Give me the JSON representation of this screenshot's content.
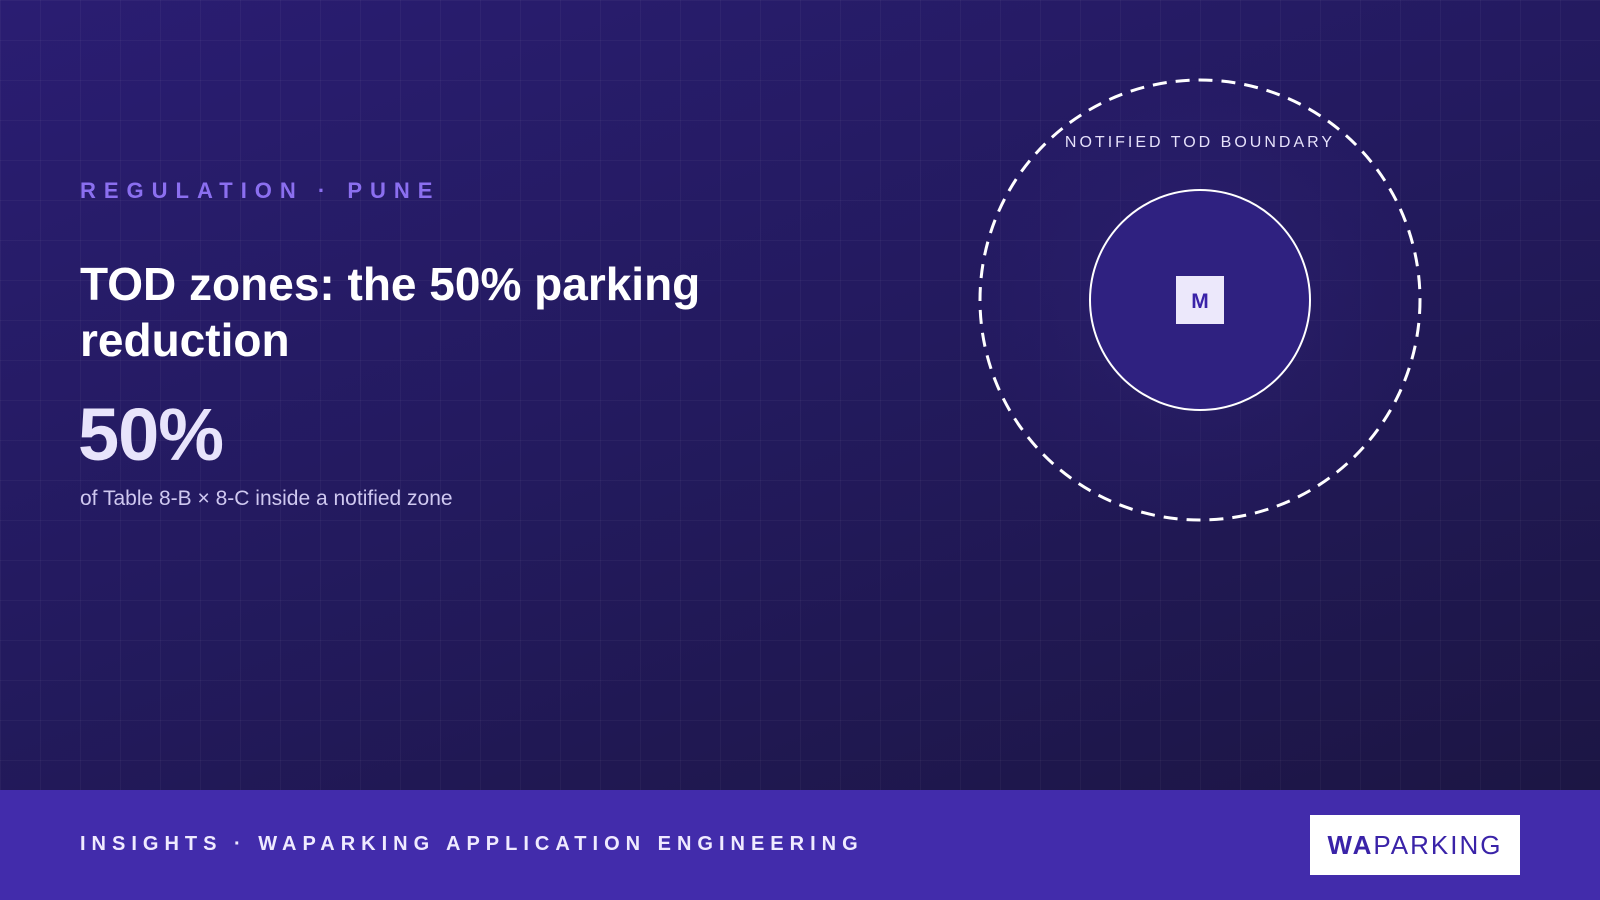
{
  "eyebrow": "REGULATION · PUNE",
  "title": "TOD zones: the 50% parking reduction",
  "stat": {
    "value": "50%",
    "caption": "of Table 8-B × 8-C inside a notified zone"
  },
  "diagram": {
    "boundary_label": "NOTIFIED TOD BOUNDARY",
    "station_label": "M"
  },
  "footer": {
    "text": "INSIGHTS · WAPARKING APPLICATION ENGINEERING",
    "logo_part1": "WA",
    "logo_part2": "PARKING"
  },
  "colors": {
    "background": "#241a62",
    "accent": "#8b6ff0",
    "footer": "#422cab",
    "logo_text": "#3a23a8"
  }
}
